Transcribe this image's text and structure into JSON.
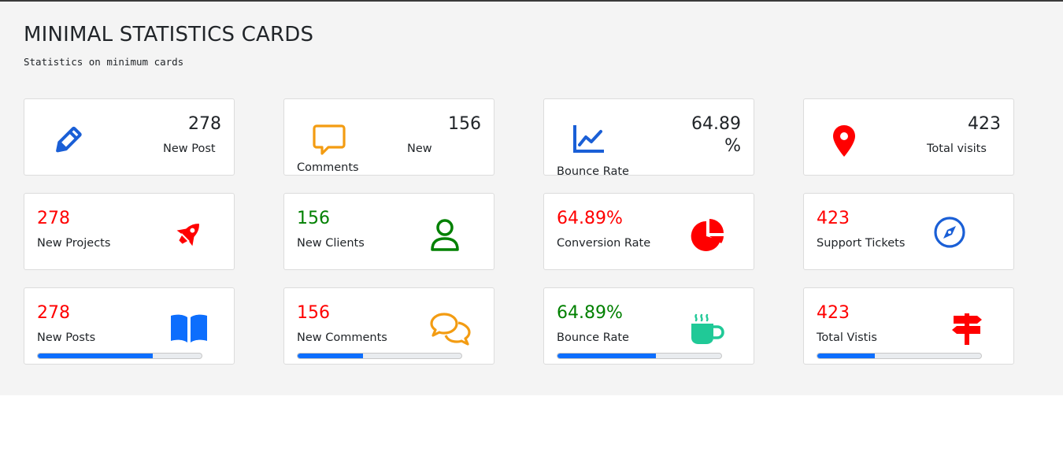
{
  "header": {
    "title": "MINIMAL STATISTICS CARDS",
    "subtitle": "Statistics on minimum cards"
  },
  "colors": {
    "blue": "#1a5fd6",
    "orange": "#f39c12",
    "red": "#ff0000",
    "green": "#008000",
    "teal": "#20c997",
    "progress": "#0d6efd"
  },
  "row1": [
    {
      "value": "278",
      "label": "New Post",
      "icon": "pencil-icon"
    },
    {
      "value": "156",
      "label_a": "New",
      "label_b": "Comments",
      "icon": "speech-bubble-icon"
    },
    {
      "value_a": "64.89",
      "value_b": "%",
      "label": "Bounce Rate",
      "icon": "line-chart-icon"
    },
    {
      "value": "423",
      "label": "Total visits",
      "icon": "map-pin-icon"
    }
  ],
  "row2": [
    {
      "value": "278",
      "label": "New Projects",
      "icon": "rocket-icon"
    },
    {
      "value": "156",
      "label": "New Clients",
      "icon": "person-icon"
    },
    {
      "value": "64.89%",
      "label": "Conversion Rate",
      "icon": "pie-chart-icon"
    },
    {
      "value": "423",
      "label": "Support Tickets",
      "icon": "compass-icon"
    }
  ],
  "row3": [
    {
      "value": "278",
      "label": "New Posts",
      "icon": "book-icon",
      "progress": 70
    },
    {
      "value": "156",
      "label": "New Comments",
      "icon": "chat-bubbles-icon",
      "progress": 40
    },
    {
      "value": "64.89%",
      "label": "Bounce Rate",
      "icon": "coffee-cup-icon",
      "progress": 60
    },
    {
      "value": "423",
      "label": "Total Vistis",
      "icon": "signpost-icon",
      "progress": 35
    }
  ]
}
